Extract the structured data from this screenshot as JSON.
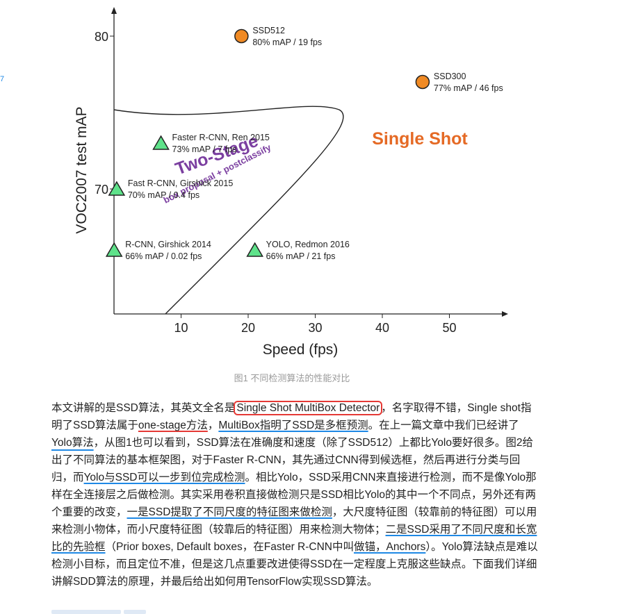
{
  "edge_mark": "7",
  "figure": {
    "caption": "图1 不同检测算法的性能对比",
    "chart_data": {
      "type": "scatter",
      "xlabel": "Speed (fps)",
      "ylabel": "VOC2007 test mAP",
      "x_ticks": [
        "10",
        "20",
        "30",
        "40",
        "50"
      ],
      "y_ticks": [
        "70",
        "80"
      ],
      "xlim": [
        0,
        60
      ],
      "ylim": [
        61,
        81
      ],
      "regions": [
        {
          "label": "Two-Stage",
          "sublabel": "box proposal + postclassify",
          "color": "#7b3fa0"
        },
        {
          "label": "Single Shot",
          "color": "#e56a25"
        }
      ],
      "points": [
        {
          "name": "SSD512",
          "detail": "80% mAP / 19 fps",
          "x": 19,
          "y": 80,
          "marker": "circle",
          "color": "#f08a24"
        },
        {
          "name": "SSD300",
          "detail": "77% mAP / 46 fps",
          "x": 46,
          "y": 77,
          "marker": "circle",
          "color": "#f08a24"
        },
        {
          "name": "Faster R-CNN, Ren 2015",
          "detail": "73% mAP / 7 fps",
          "x": 7,
          "y": 73,
          "marker": "triangle",
          "color": "#5ee28a"
        },
        {
          "name": "Fast R-CNN, Girshick 2015",
          "detail": "70% mAP / 0.4 fps",
          "x": 0.4,
          "y": 70,
          "marker": "triangle",
          "color": "#5ee28a"
        },
        {
          "name": "R-CNN, Girshick 2014",
          "detail": "66% mAP / 0.02 fps",
          "x": 0.02,
          "y": 66,
          "marker": "triangle",
          "color": "#5ee28a"
        },
        {
          "name": "YOLO, Redmon 2016",
          "detail": "66% mAP / 21 fps",
          "x": 21,
          "y": 66,
          "marker": "triangle",
          "color": "#5ee28a"
        }
      ]
    }
  },
  "article": {
    "p1": "本文讲解的是SSD算法，其英文全名是",
    "p2": "Single Shot MultiBox Detector",
    "p3": "，名字取得不错，Single shot指明了SSD算法属于",
    "p4": "one-stage方法",
    "p5": "，",
    "p6": "MultiBox指明了SSD是多框预测",
    "p7": "。在上一篇文章中我们已经讲了",
    "p8": "Yolo算法",
    "p9": "，从图1也可以看到，SSD算法在准确度和速度（除了SSD512）上都比Yolo要好很多。图2给出了不同算法的基本框架图，对于Faster R-CNN，其先通过CNN得到候选框，然后再进行分类与回归，而",
    "p10": "Yolo与SSD可以一步到位完成检测",
    "p11": "。相比Yolo，SSD采用CNN来直接进行检测，而不是像Yolo那样在全连接层之后做检测。其实采用卷积直接做检测只是SSD相比Yolo的其中一个不同点，另外还有两个重要的改变，",
    "p12": "一是SSD提取了不同尺度的特征图来做检测",
    "p13": "，大尺度特征图（较靠前的特征图）可以用来检测小物体，而小尺度特征图（较靠后的特征图）用来检测大物体；",
    "p14": "二是SSD采用了不同尺度和长宽比的先验框",
    "p15": "（Prior boxes, Default boxes，在Faster R-CNN中叫",
    "p16": "做锚，Anchors",
    "p17": "）。Yolo算法缺点是难以检测小目标，而且定位不准，但是这几点重要改进使得SSD在一定程度上克服这些缺点。下面我们详细讲解SDD算法的原理，并最后给出如何用TensorFlow实现SSD算法。"
  }
}
